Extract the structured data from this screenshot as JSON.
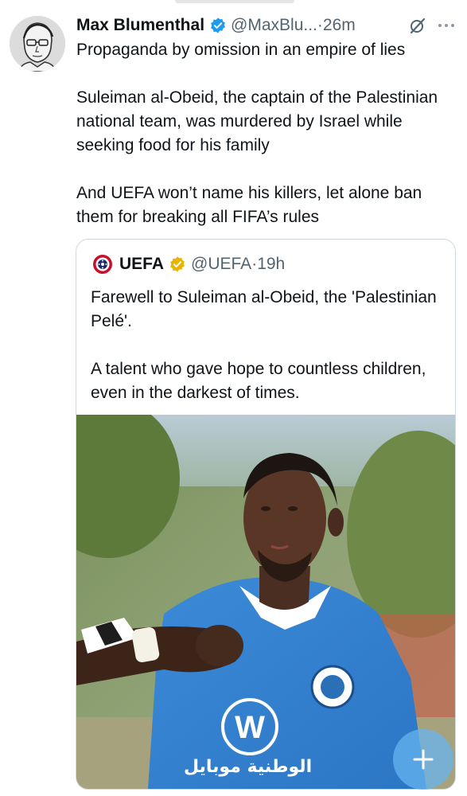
{
  "tweet": {
    "author_name": "Max Blumenthal",
    "handle": "@MaxBlu...",
    "separator": "·",
    "time": "26m",
    "paragraphs": [
      "Propaganda by omission in an empire of lies",
      "Suleiman al-Obeid, the captain of the Palestinian national team, was murdered by Israel while seeking food for his family",
      "And UEFA won’t name his killers, let alone ban them for breaking all FIFA’s rules"
    ]
  },
  "quoted_tweet": {
    "author_name": "UEFA",
    "handle": "@UEFA",
    "separator": "·",
    "time": "19h",
    "paragraphs": [
      "Farewell to Suleiman al-Obeid, the 'Palestinian Pelé'.",
      "A talent who gave hope to countless children, even in the darkest of times."
    ],
    "media": {
      "jersey_sponsor": "الوطنية موبايل"
    }
  },
  "icons": {
    "verified": "verified-badge-icon",
    "grok": "grok-icon",
    "more": "more-options-icon",
    "compose": "compose-plus-icon"
  },
  "colors": {
    "accent": "#1d9bf0",
    "gold_badge": "#e8b400",
    "secondary_text": "#536471"
  }
}
